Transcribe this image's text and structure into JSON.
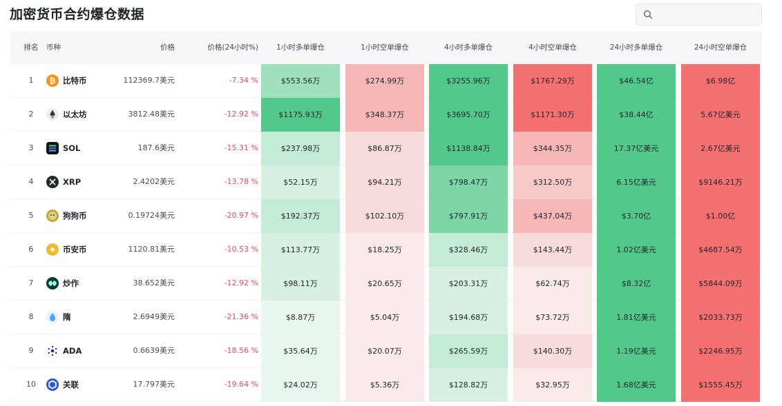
{
  "page": {
    "title": "加密货币合约爆仓数据"
  },
  "search": {
    "placeholder": ""
  },
  "colors": {
    "green_scale": [
      "#e9f6ee",
      "#d6f1e2",
      "#c3ebd5",
      "#9fe0bd",
      "#7dd6a6",
      "#52c98b"
    ],
    "red_scale": [
      "#fbeaea",
      "#f8dcdc",
      "#f7c9c9",
      "#f6b7b7",
      "#f59898",
      "#f57070"
    ],
    "negative_text": "#f6465d"
  },
  "table": {
    "headers": {
      "rank": "排名",
      "coin": "币种",
      "price": "价格",
      "change": "价格(24小时%)",
      "long_1h": "1小时多单爆仓",
      "short_1h": "1小时空单爆仓",
      "long_4h": "4小时多单爆仓",
      "short_4h": "4小时空单爆仓",
      "long_24h": "24小时多单爆仓",
      "short_24h": "24小时空单爆仓"
    },
    "rows": [
      {
        "rank": "1",
        "icon": "bitcoin-icon",
        "icon_color": "#f7931a",
        "name": "比特币",
        "price": "112369.7美元",
        "change": "-7.34 %",
        "liq": [
          "$553.56万",
          "$274.99万",
          "$3255.96万",
          "$1767.29万",
          "$46.54亿",
          "$6.98亿"
        ],
        "lvl": [
          3,
          3,
          5,
          5,
          5,
          5
        ]
      },
      {
        "rank": "2",
        "icon": "ethereum-icon",
        "icon_color": "#627eea",
        "name": "以太坊",
        "price": "3812.48美元",
        "change": "-12.92 %",
        "liq": [
          "$1175.93万",
          "$348.37万",
          "$3695.70万",
          "$1171.30万",
          "$38.44亿",
          "5.67亿美元"
        ],
        "lvl": [
          5,
          3,
          5,
          5,
          5,
          5
        ]
      },
      {
        "rank": "3",
        "icon": "solana-icon",
        "icon_color": "#14f195",
        "name": "SOL",
        "price": "187.6美元",
        "change": "-15.31 %",
        "liq": [
          "$237.98万",
          "$86.87万",
          "$1138.84万",
          "$344.35万",
          "17.37亿美元",
          "2.67亿美元"
        ],
        "lvl": [
          2,
          1,
          5,
          3,
          5,
          5
        ]
      },
      {
        "rank": "4",
        "icon": "xrp-icon",
        "icon_color": "#23292f",
        "name": "XRP",
        "price": "2.4202美元",
        "change": "-13.78 %",
        "liq": [
          "$52.15万",
          "$94.21万",
          "$798.47万",
          "$312.50万",
          "6.15亿美元",
          "$9146.21万"
        ],
        "lvl": [
          1,
          1,
          4,
          2,
          5,
          5
        ]
      },
      {
        "rank": "5",
        "icon": "dogecoin-icon",
        "icon_color": "#c2a633",
        "name": "狗狗币",
        "price": "0.19724美元",
        "change": "-20.97 %",
        "liq": [
          "$192.37万",
          "$102.10万",
          "$797.91万",
          "$437.04万",
          "$3.70亿",
          "$1.00亿"
        ],
        "lvl": [
          2,
          1,
          4,
          3,
          5,
          5
        ]
      },
      {
        "rank": "6",
        "icon": "bnb-icon",
        "icon_color": "#f3ba2f",
        "name": "币安币",
        "price": "1120.81美元",
        "change": "-10.53 %",
        "liq": [
          "$113.77万",
          "$18.25万",
          "$328.46万",
          "$143.44万",
          "1.02亿美元",
          "$4687.54万"
        ],
        "lvl": [
          1,
          0,
          2,
          1,
          5,
          5
        ]
      },
      {
        "rank": "7",
        "icon": "hype-icon",
        "icon_color": "#0f3933",
        "name": "炒作",
        "price": "38.652美元",
        "change": "-12.92 %",
        "liq": [
          "$98.11万",
          "$20.65万",
          "$203.31万",
          "$62.74万",
          "$8.32亿",
          "$5844.09万"
        ],
        "lvl": [
          1,
          0,
          1,
          0,
          5,
          5
        ]
      },
      {
        "rank": "8",
        "icon": "sui-icon",
        "icon_color": "#4da2ff",
        "name": "隋",
        "price": "2.6949美元",
        "change": "-21.36 %",
        "liq": [
          "$8.87万",
          "$5.04万",
          "$194.68万",
          "$73.72万",
          "1.81亿美元",
          "$2033.73万"
        ],
        "lvl": [
          0,
          0,
          1,
          0,
          5,
          5
        ]
      },
      {
        "rank": "9",
        "icon": "cardano-icon",
        "icon_color": "#0033ad",
        "name": "ADA",
        "price": "0.6639美元",
        "change": "-18.56 %",
        "liq": [
          "$35.64万",
          "$20.07万",
          "$265.59万",
          "$140.30万",
          "1.19亿美元",
          "$2246.95万"
        ],
        "lvl": [
          0,
          0,
          2,
          1,
          5,
          5
        ]
      },
      {
        "rank": "10",
        "icon": "chainlink-icon",
        "icon_color": "#2a5ada",
        "name": "关联",
        "price": "17.797美元",
        "change": "-19.64 %",
        "liq": [
          "$24.02万",
          "$5.36万",
          "$128.82万",
          "$32.95万",
          "1.68亿美元",
          "$1555.45万"
        ],
        "lvl": [
          0,
          0,
          1,
          0,
          5,
          5
        ]
      }
    ]
  }
}
